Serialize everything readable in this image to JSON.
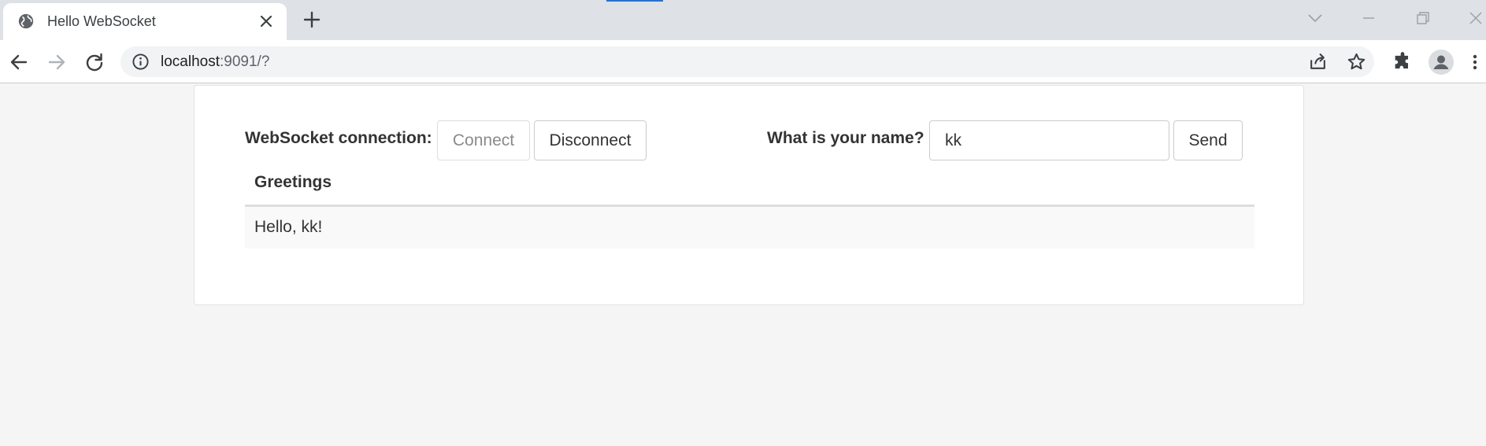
{
  "browser": {
    "tab": {
      "title": "Hello WebSocket"
    },
    "address": {
      "host": "localhost",
      "rest": ":9091/?"
    }
  },
  "page": {
    "connection_label": "WebSocket connection:",
    "connect_label": "Connect",
    "disconnect_label": "Disconnect",
    "name_label": "What is your name?",
    "name_value": "kk",
    "send_label": "Send",
    "greetings_header": "Greetings",
    "greetings": [
      "Hello, kk!"
    ]
  },
  "colors": {
    "accent": "#1a73e8",
    "tabstrip": "#dee1e6",
    "page_bg": "#f5f5f5"
  },
  "icons": {
    "favicon": "globe-icon",
    "tab_close": "close-icon",
    "new_tab": "plus-icon",
    "back": "arrow-left-icon",
    "forward": "arrow-right-icon",
    "reload": "reload-icon",
    "info": "info-icon",
    "share": "share-icon",
    "bookmark": "star-icon",
    "extensions": "puzzle-icon",
    "profile": "avatar-icon",
    "menu": "kebab-menu-icon"
  }
}
